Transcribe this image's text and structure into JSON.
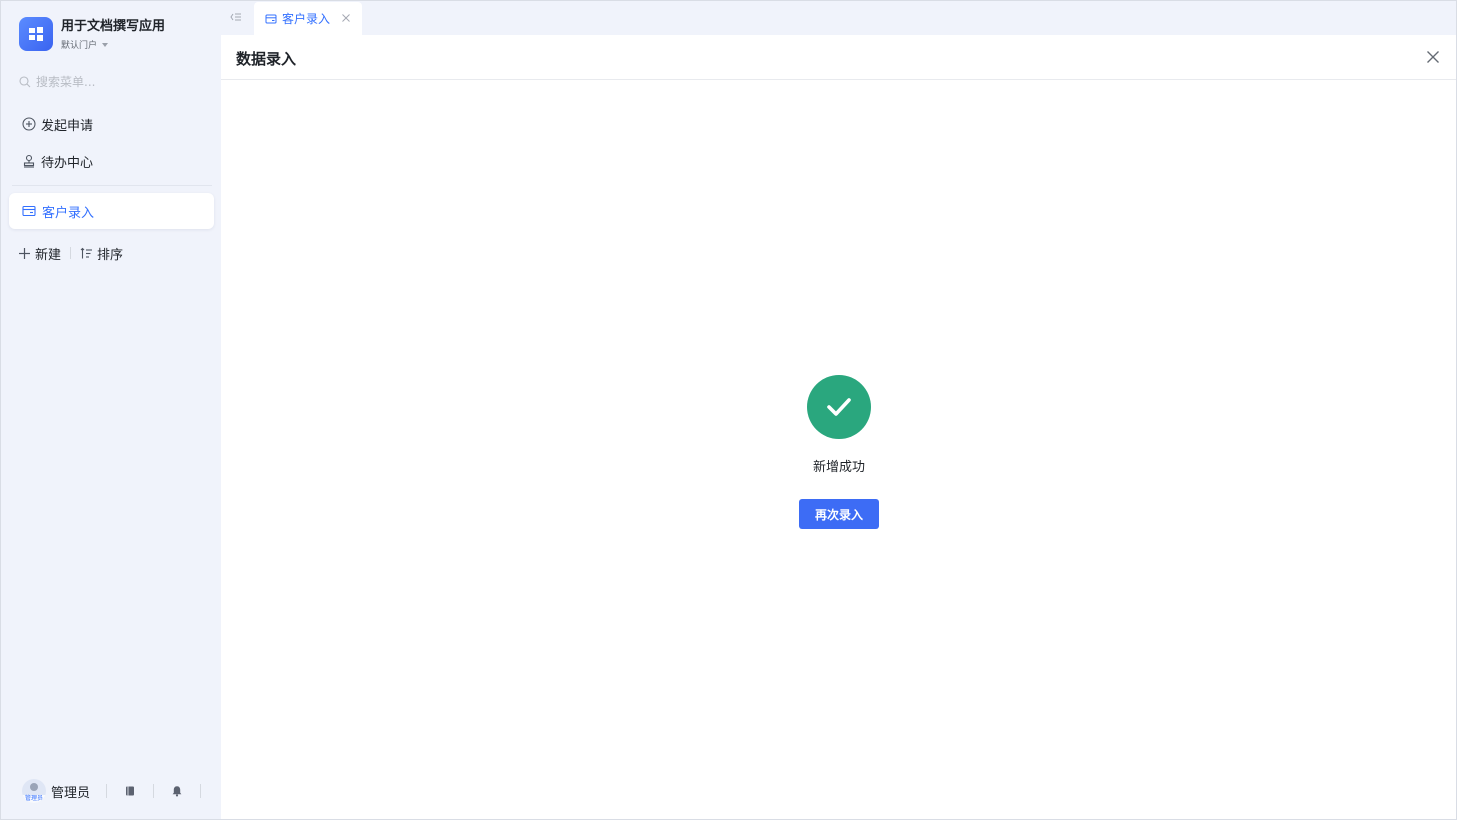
{
  "app": {
    "name": "用于文档撰写应用",
    "portal": "默认门户"
  },
  "search": {
    "placeholder": "搜索菜单..."
  },
  "sidebar": {
    "items": [
      {
        "label": "发起申请",
        "icon": "plus-circle-icon"
      },
      {
        "label": "待办中心",
        "icon": "stamp-icon"
      }
    ],
    "active_item": {
      "label": "客户录入",
      "icon": "form-icon"
    },
    "actions": {
      "new_label": "新建",
      "sort_label": "排序"
    }
  },
  "user": {
    "name": "管理员",
    "avatar_tag": "管理员"
  },
  "tabs": [
    {
      "label": "客户录入",
      "active": true
    }
  ],
  "main": {
    "title": "数据录入",
    "success_message": "新增成功",
    "again_button": "再次录入"
  },
  "colors": {
    "accent": "#3370ff",
    "success": "#2aa77e",
    "button": "#3d6cf5",
    "sidebar_bg": "#f0f3fb"
  }
}
